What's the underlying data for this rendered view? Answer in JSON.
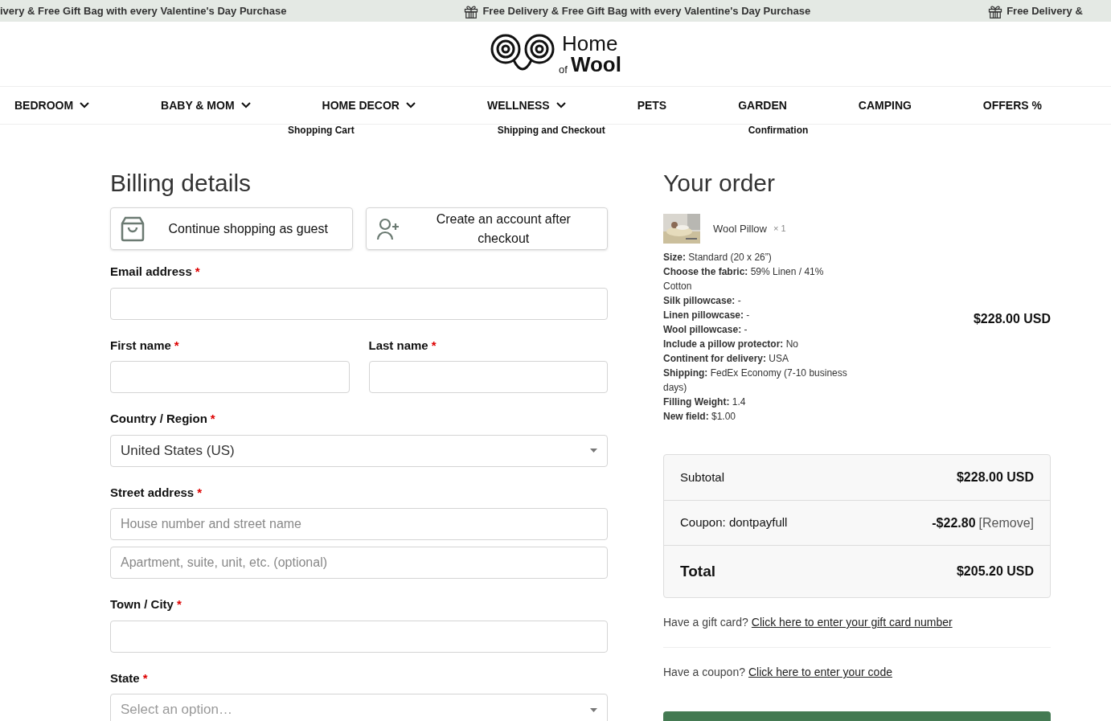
{
  "banner": {
    "items": [
      {
        "text": "ivery & Free Gift Bag with every Valentine's Day Purchase",
        "icon": false
      },
      {
        "text": "Free Delivery & Free Gift Bag with every Valentine's Day Purchase",
        "icon": true
      },
      {
        "text": "Free Delivery &",
        "icon": true
      }
    ]
  },
  "logo": {
    "top": "Home",
    "small": "of",
    "bottom": "Wool"
  },
  "nav": [
    {
      "label": "BEDROOM",
      "dropdown": true
    },
    {
      "label": "BABY & MOM",
      "dropdown": true
    },
    {
      "label": "HOME DECOR",
      "dropdown": true
    },
    {
      "label": "WELLNESS",
      "dropdown": true
    },
    {
      "label": "PETS",
      "dropdown": false
    },
    {
      "label": "GARDEN",
      "dropdown": false
    },
    {
      "label": "CAMPING",
      "dropdown": false
    },
    {
      "label": "OFFERS %",
      "dropdown": false
    }
  ],
  "steps": [
    "Shopping Cart",
    "Shipping and Checkout",
    "Confirmation"
  ],
  "billing": {
    "title": "Billing details",
    "account_options": [
      {
        "label": "Continue shopping as guest",
        "kind": "bag"
      },
      {
        "label": "Create an account after checkout",
        "kind": "user-plus"
      }
    ],
    "rows": [
      [
        {
          "label": "Email address",
          "required_mark": "*",
          "kind": "text"
        }
      ],
      [
        {
          "label": "First name",
          "required_mark": "*",
          "kind": "text"
        },
        {
          "label": "Last name",
          "required_mark": "*",
          "kind": "text"
        }
      ],
      [
        {
          "label": "Country / Region",
          "required_mark": "*",
          "kind": "select",
          "value": "United States (US)"
        }
      ],
      [
        {
          "label": "Street address",
          "required_mark": "*",
          "kind": "text",
          "placeholder": "House number and street name"
        }
      ],
      [
        {
          "kind": "text",
          "placeholder": "Apartment, suite, unit, etc. (optional)"
        }
      ],
      [
        {
          "label": "Town / City",
          "required_mark": "*",
          "kind": "text"
        }
      ],
      [
        {
          "label": "State",
          "required_mark": "*",
          "kind": "select",
          "placeholder": "Select an option…"
        }
      ]
    ]
  },
  "order": {
    "title": "Your order",
    "item": {
      "name": "Wool Pillow",
      "qty": "× 1",
      "price": "$228.00 USD",
      "details": [
        "**Size:** Standard (20 x 26”)",
        "**Choose the fabric:** 59% Linen / 41% Cotton",
        "**Silk pillowcase:** -",
        "**Linen pillowcase:** -",
        "**Wool pillowcase:** -",
        "**Include a pillow protector:** No",
        "**Continent for delivery:** USA",
        "**Shipping:** FedEx Economy (7-10 business days)",
        "**Filling Weight:** 1.4",
        "**New field:** $1.00"
      ]
    },
    "totals": [
      {
        "label": "Subtotal",
        "value": "$228.00 USD",
        "kind": "normal"
      },
      {
        "label": "Coupon: dontpayfull",
        "value": "-$22.80",
        "action": "[Remove]",
        "kind": "coupon"
      },
      {
        "label": "Total",
        "value": "$205.20 USD",
        "kind": "total"
      }
    ],
    "prompts": [
      {
        "text": "Have a gift card?",
        "link": "Click here to enter your gift card number"
      },
      {
        "text": "Have a coupon?",
        "link": "Click here to enter your code"
      }
    ]
  }
}
